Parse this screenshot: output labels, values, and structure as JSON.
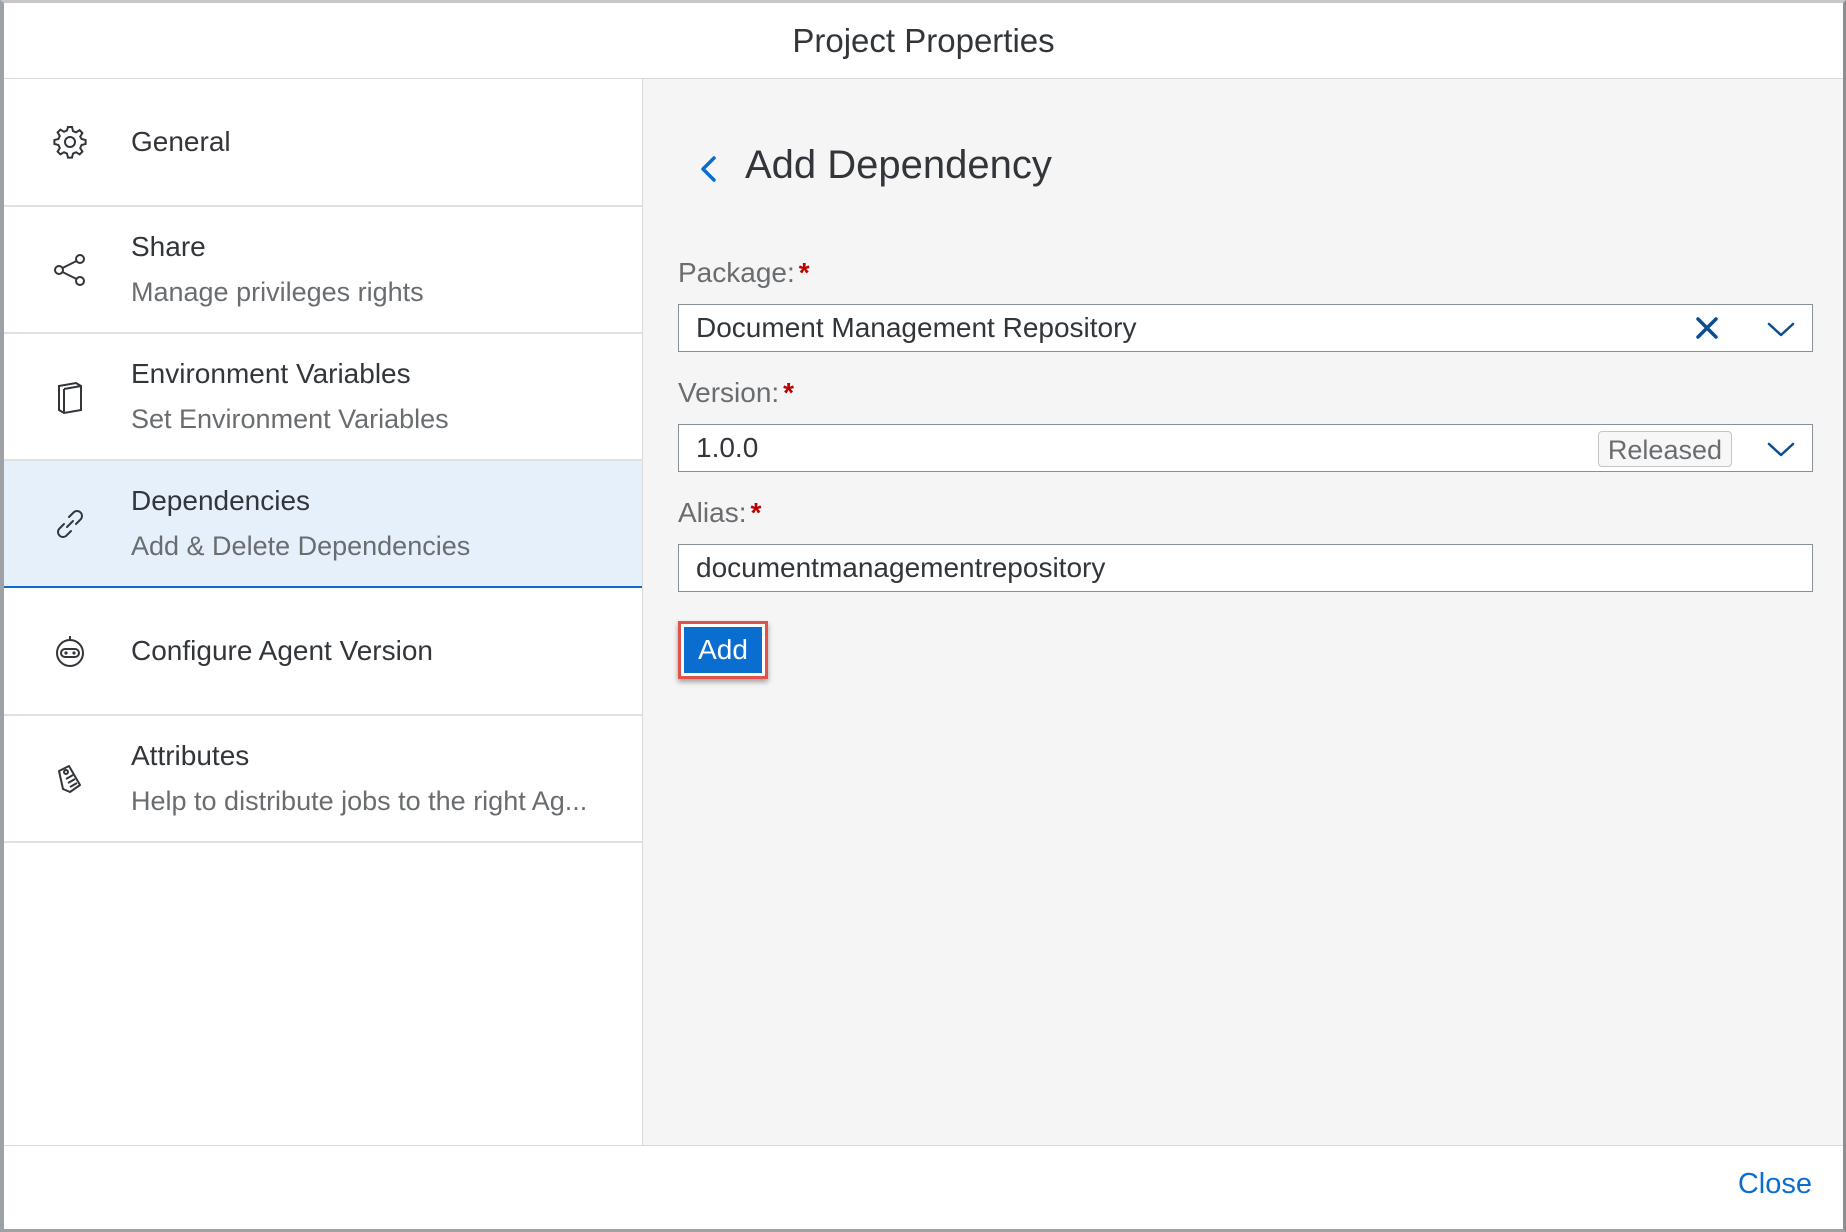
{
  "dialog": {
    "title": "Project Properties"
  },
  "sidebar": {
    "items": [
      {
        "icon": "gear-icon",
        "title": "General",
        "subtitle": ""
      },
      {
        "icon": "share-icon",
        "title": "Share",
        "subtitle": "Manage privileges rights"
      },
      {
        "icon": "document-icon",
        "title": "Environment Variables",
        "subtitle": "Set Environment Variables"
      },
      {
        "icon": "link-icon",
        "title": "Dependencies",
        "subtitle": "Add & Delete Dependencies",
        "selected": true
      },
      {
        "icon": "robot-icon",
        "title": "Configure Agent Version",
        "subtitle": ""
      },
      {
        "icon": "tag-icon",
        "title": "Attributes",
        "subtitle": "Help to distribute jobs to the right Ag..."
      }
    ]
  },
  "form": {
    "title": "Add Dependency",
    "package": {
      "label": "Package:",
      "required": "*",
      "value": "Document Management Repository"
    },
    "version": {
      "label": "Version:",
      "required": "*",
      "value": "1.0.0",
      "status": "Released"
    },
    "alias": {
      "label": "Alias:",
      "required": "*",
      "value": "documentmanagementrepository"
    },
    "add_label": "Add"
  },
  "footer": {
    "close_label": "Close"
  },
  "colors": {
    "accent": "#0a6ed1",
    "required": "#bb0000",
    "highlight": "#e0534b",
    "selected_bg": "#e5f0fa"
  }
}
